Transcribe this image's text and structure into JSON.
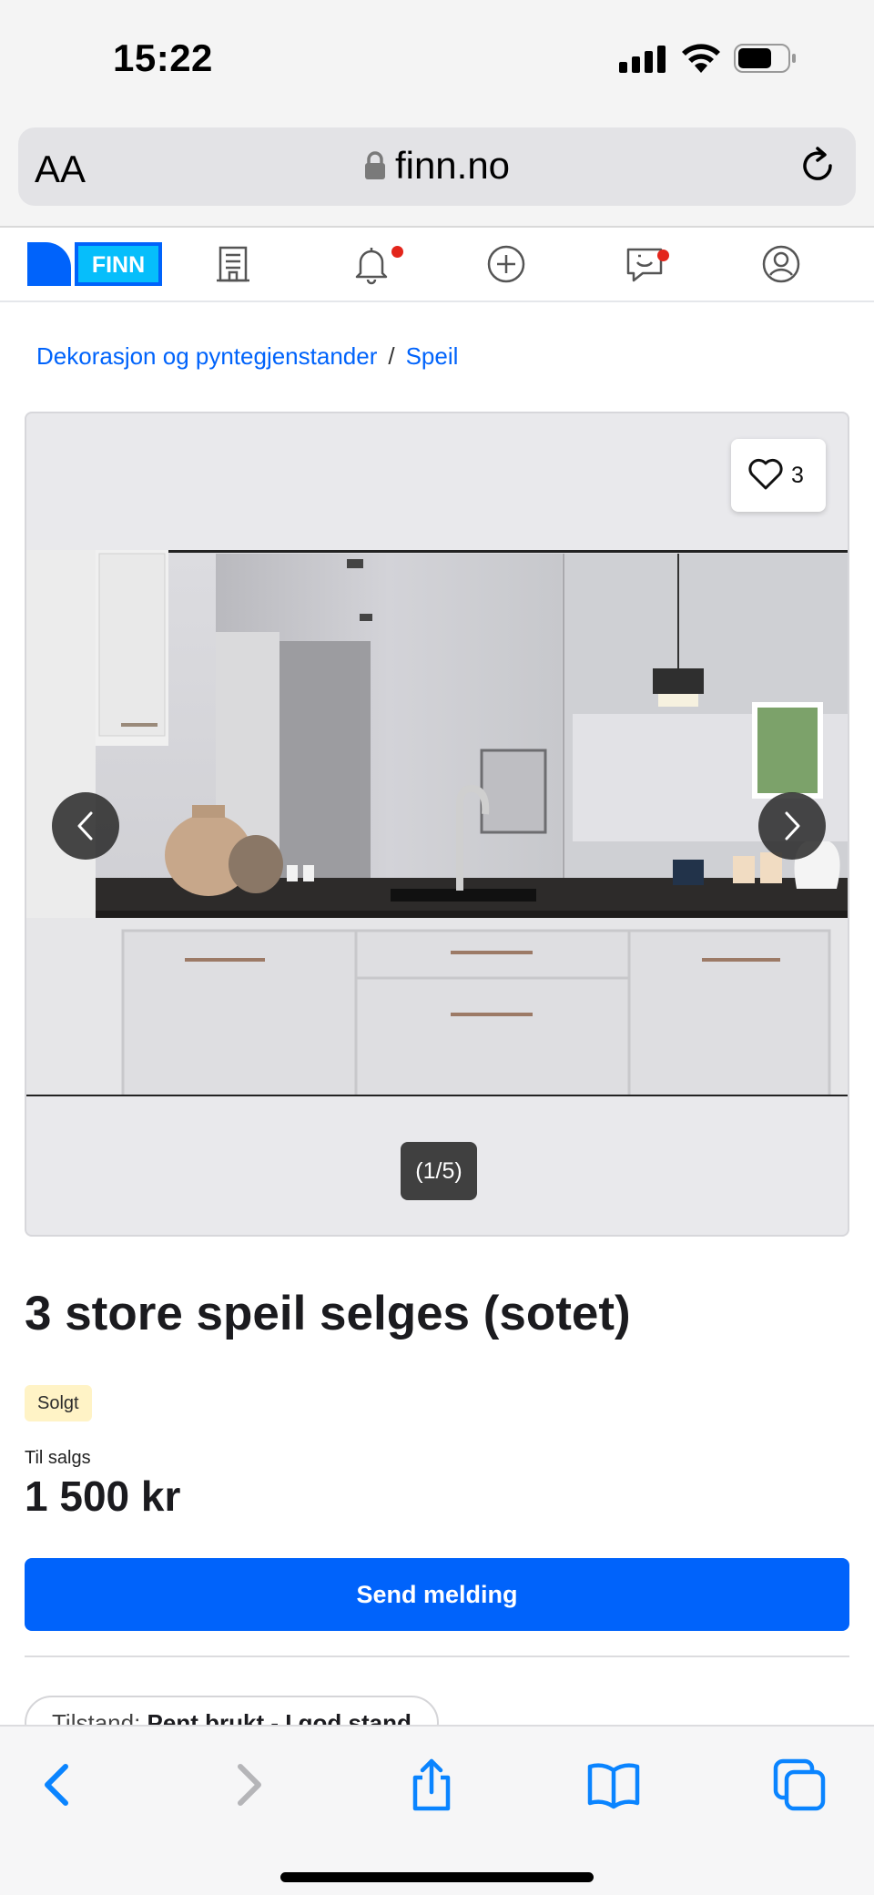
{
  "status_bar": {
    "time": "15:22"
  },
  "browser": {
    "text_size_label": "AA",
    "url": "finn.no"
  },
  "nav": {
    "logo_text": "FINN",
    "brand_color": "#0063fb",
    "notification_color": "#e3251b",
    "items": [
      {
        "name": "realestate-icon"
      },
      {
        "name": "notifications-icon",
        "has_dot": true
      },
      {
        "name": "new-ad-icon"
      },
      {
        "name": "messages-icon",
        "has_dot": true
      },
      {
        "name": "profile-icon"
      }
    ]
  },
  "breadcrumb": {
    "items": [
      "Dekorasjon og pyntegjenstander",
      "Speil"
    ],
    "separator": "/"
  },
  "gallery": {
    "favorite_count": "3",
    "image_counter": "(1/5)"
  },
  "listing": {
    "title": "3 store speil selges (sotet)",
    "status_badge": "Solgt",
    "price_label": "Til salgs",
    "price": "1 500 kr",
    "cta_label": "Send melding",
    "condition_label": "Tilstand:",
    "condition_value": "Pent brukt - I god stand"
  },
  "bottom_toolbar": {
    "items": [
      "back-icon",
      "forward-icon",
      "share-icon",
      "bookmarks-icon",
      "tabs-icon"
    ]
  }
}
